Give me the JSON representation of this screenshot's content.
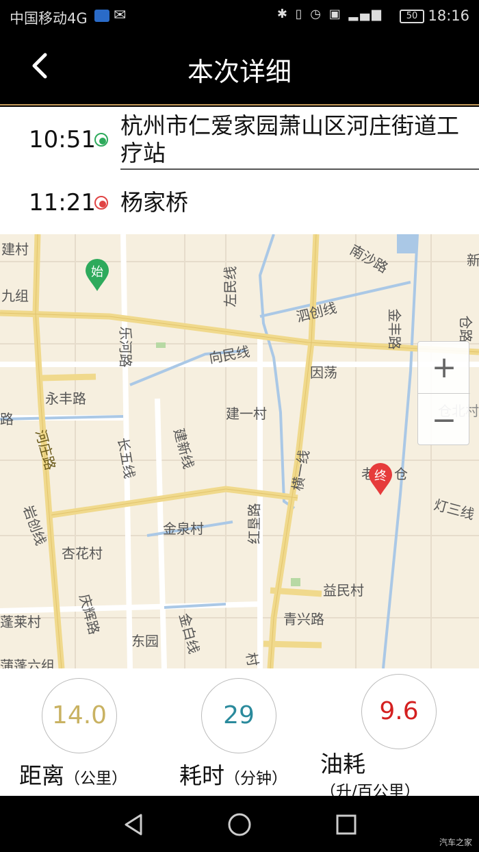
{
  "status_bar": {
    "carrier": "中国移动4G",
    "battery": "50",
    "time": "18:16",
    "icons": [
      "app-badge-icon",
      "wechat-icon",
      "bluetooth-icon",
      "vibrate-icon",
      "alarm-icon",
      "hd-icon",
      "signal-icon",
      "battery-icon"
    ]
  },
  "header": {
    "title": "本次详细",
    "back_icon": "back-chevron-icon"
  },
  "route": {
    "start": {
      "time": "10:51",
      "place": "杭州市仁爱家园萧山区河庄街道工疗站",
      "color": "#2eaa5c"
    },
    "end": {
      "time": "11:21",
      "place": "杨家桥",
      "color": "#e04444"
    }
  },
  "map": {
    "labels": [
      "建村",
      "九组",
      "南沙路",
      "新",
      "左民线",
      "泗创线",
      "乐河路",
      "金丰路",
      "仓路",
      "向民线",
      "因荡",
      "永丰路",
      "路",
      "建一村",
      "仓北村",
      "河庄路",
      "长五线",
      "建新线",
      "老",
      "仓",
      "灯三线",
      "岩创线",
      "金泉村",
      "红垦路",
      "横一线",
      "杏花村",
      "益民村",
      "庆辉路",
      "蓬莱村",
      "青兴路",
      "东园",
      "金白线",
      "蒲蓬六组",
      "村"
    ],
    "start_marker": "始",
    "end_marker": "终",
    "zoom_in": "+",
    "zoom_out": "−"
  },
  "stats": {
    "distance": {
      "value": "14.0",
      "label": "距离",
      "unit": "（公里）",
      "color": "#c9b262"
    },
    "duration": {
      "value": "29",
      "label": "耗时",
      "unit": "（分钟）",
      "color": "#2a8a9c"
    },
    "fuel": {
      "value": "9.6",
      "label": "油耗",
      "unit": "（升/百公里）",
      "color": "#d42020"
    }
  },
  "nav_bar": {
    "icons": [
      "back-triangle-icon",
      "home-circle-icon",
      "recents-square-icon"
    ],
    "watermark": "汽车之家"
  }
}
